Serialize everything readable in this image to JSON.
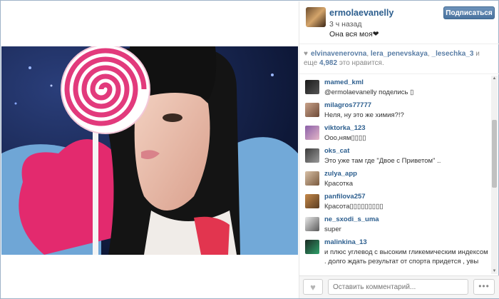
{
  "post": {
    "username": "ermolaevanelly",
    "time": "3 ч назад",
    "caption": "Она вся моя❤",
    "follow_label": "Подписаться"
  },
  "likes": {
    "user1": "elvinavenerovna",
    "user2": "lera_penevskaya",
    "user3": "_lesechka_3",
    "and_more": "и еще",
    "count": "4,982",
    "suffix": "это нравится."
  },
  "comments": [
    {
      "user": "mamed_kml",
      "text": "@ermolaevanelly поделись ▯"
    },
    {
      "user": "milagros77777",
      "text": "Неля, ну это же химия?!?"
    },
    {
      "user": "viktorka_123",
      "text": "Ооо,ням▯▯▯▯"
    },
    {
      "user": "oks_cat",
      "text": "Это уже там где \"Двое с Приветом\" .."
    },
    {
      "user": "zulya_app",
      "text": "Красотка"
    },
    {
      "user": "panfilova257",
      "text": "Красота▯▯▯▯▯▯▯▯▯"
    },
    {
      "user": "ne_sxodi_s_uma",
      "text": "super"
    },
    {
      "user": "malinkina_13",
      "text": "и плюс углевод с высоким гликемическим индексом . долго ждать результат от спорта придется , увы"
    }
  ],
  "footer": {
    "comment_placeholder": "Оставить комментарий...",
    "more_label": "•••"
  },
  "icons": {
    "like": "heart-icon",
    "more": "more-icon"
  },
  "colors": {
    "username": "#2c5e8e",
    "follow_button": "#4a739f"
  }
}
